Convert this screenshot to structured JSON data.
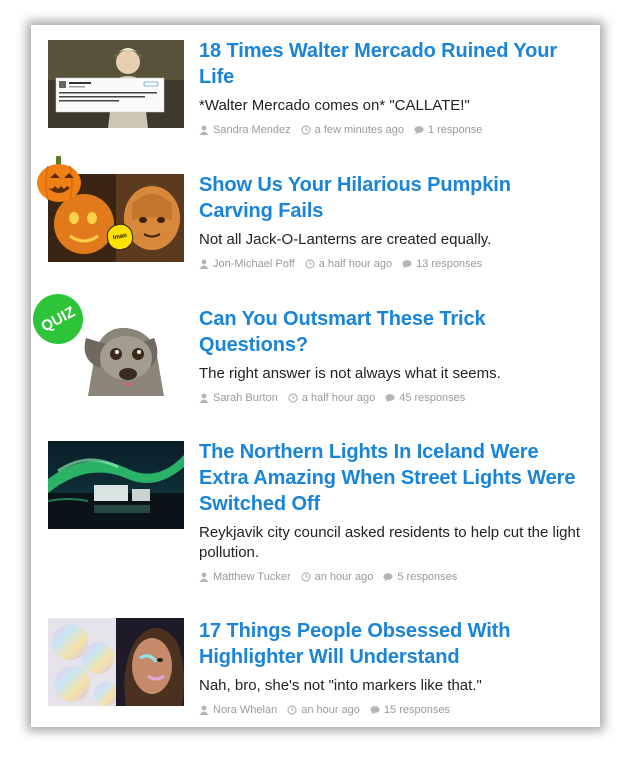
{
  "articles": [
    {
      "title": "18 Times Walter Mercado Ruined Your Life",
      "description": "*Walter Mercado comes on* \"CALLATE!\"",
      "author": "Sandra Mendez",
      "time": "a few minutes ago",
      "responses": "1 response",
      "thumb_icon": "walter-mercado-tweet-image"
    },
    {
      "title": "Show Us Your Hilarious Pumpkin Carving Fails",
      "description": "Not all Jack-O-Lanterns are created equally.",
      "author": "Jon-Michael Poff",
      "time": "a half hour ago",
      "responses": "13 responses",
      "thumb_icon": "pumpkin-carving-image",
      "badge_label": "lmao"
    },
    {
      "title": "Can You Outsmart These Trick Questions?",
      "description": "The right answer is not always what it seems.",
      "author": "Sarah Burton",
      "time": "a half hour ago",
      "responses": "45 responses",
      "thumb_icon": "tilted-dog-image",
      "badge_label": "QUIZ"
    },
    {
      "title": "The Northern Lights In Iceland Were Extra Amazing When Street Lights Were Switched Off",
      "description": "Reykjavik city council asked residents to help cut the light pollution.",
      "author": "Matthew Tucker",
      "time": "an hour ago",
      "responses": "5 responses",
      "thumb_icon": "northern-lights-image"
    },
    {
      "title": "17 Things People Obsessed With Highlighter Will Understand",
      "description": "Nah, bro, she's not \"into markers like that.\"",
      "author": "Nora Whelan",
      "time": "an hour ago",
      "responses": "15 responses",
      "thumb_icon": "highlighter-makeup-image"
    }
  ],
  "colors": {
    "title": "#1a84d8",
    "meta": "#9a9a9a",
    "quiz_badge": "#2ec43a",
    "lmao_badge": "#ffe000"
  }
}
